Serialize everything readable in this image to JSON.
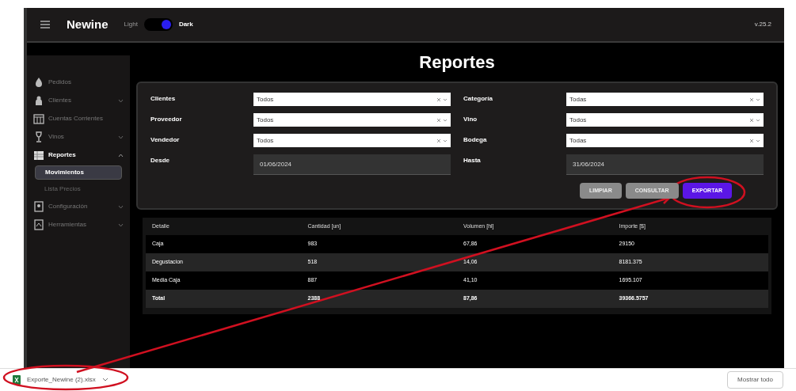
{
  "header": {
    "brand": "Newine",
    "theme": {
      "light_label": "Light",
      "dark_label": "Dark",
      "dark": true
    },
    "version": "v.25.2"
  },
  "sidebar": {
    "items": [
      {
        "label": "Pedidos",
        "selected": false
      },
      {
        "label": "Clientes",
        "selected": false,
        "expanded": false
      },
      {
        "label": "Cuentas Corrientes",
        "selected": false
      },
      {
        "label": "Vinos",
        "selected": false,
        "expanded": false
      },
      {
        "label": "Reportes",
        "selected": true,
        "expanded": true,
        "children": [
          {
            "label": "Movimientos",
            "selected": true
          },
          {
            "label": "Lista Precios",
            "selected": false
          }
        ]
      },
      {
        "label": "Configuración",
        "selected": false,
        "expanded": false
      },
      {
        "label": "Herramientas",
        "selected": false,
        "expanded": false
      }
    ]
  },
  "page": {
    "title": "Reportes"
  },
  "filters": {
    "left": [
      {
        "kind": "select",
        "label": "Clientes",
        "value": "Todos"
      },
      {
        "kind": "select",
        "label": "Proveedor",
        "value": "Todos"
      },
      {
        "kind": "select",
        "label": "Vendedor",
        "value": "Todos"
      },
      {
        "kind": "date",
        "label": "Desde",
        "value": "01/06/2024"
      }
    ],
    "right": [
      {
        "kind": "select",
        "label": "Categoría",
        "value": "Todas"
      },
      {
        "kind": "select",
        "label": "Vino",
        "value": "Todos"
      },
      {
        "kind": "select",
        "label": "Bodega",
        "value": "Todas"
      },
      {
        "kind": "date",
        "label": "Hasta",
        "value": "31/06/2024"
      }
    ],
    "buttons": [
      {
        "label": "LIMPIAR",
        "kind": "secondary"
      },
      {
        "label": "CONSULTAR",
        "kind": "secondary"
      },
      {
        "label": "EXPORTAR",
        "kind": "primary"
      }
    ]
  },
  "table": {
    "columns": [
      "Detalle",
      "Cantidad [un]",
      "Volumen [hl]",
      "Importe [$]"
    ],
    "rows": [
      {
        "cells": [
          "Caja",
          "983",
          "67,86",
          "29150"
        ],
        "bold": false
      },
      {
        "cells": [
          "Degustacion",
          "518",
          "14,06",
          "8181.375"
        ],
        "bold": false
      },
      {
        "cells": [
          "Media Caja",
          "887",
          "41,10",
          "1695.107"
        ],
        "bold": false
      },
      {
        "cells": [
          "Total",
          "2388",
          "87,86",
          "39366.5757"
        ],
        "bold": true
      }
    ]
  },
  "downloads": {
    "file": "Exporte_Newine (2).xlsx",
    "show_all": "Mostrar todo"
  }
}
